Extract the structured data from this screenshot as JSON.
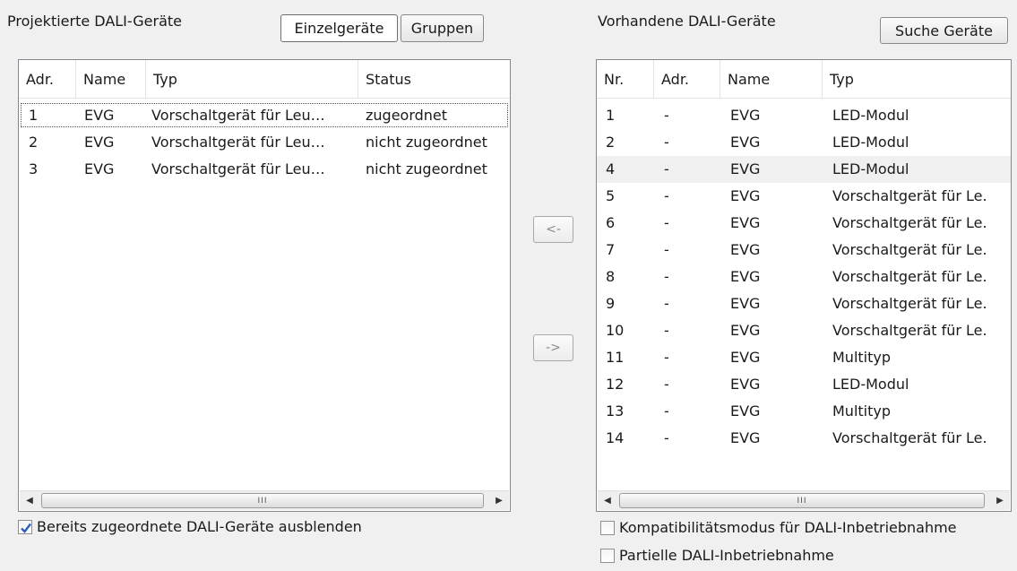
{
  "left": {
    "title": "Projektierte DALI-Geräte",
    "btn_single": "Einzelgeräte",
    "btn_groups": "Gruppen",
    "columns": [
      "Adr.",
      "Name",
      "Typ",
      "Status"
    ],
    "rows": [
      [
        "1",
        "EVG",
        "Vorschaltgerät für Leu…",
        "zugeordnet"
      ],
      [
        "2",
        "EVG",
        "Vorschaltgerät für Leu…",
        "nicht zugeordnet"
      ],
      [
        "3",
        "EVG",
        "Vorschaltgerät für Leu…",
        "nicht zugeordnet"
      ]
    ],
    "hide_checkbox": {
      "label": "Bereits zugeordnete DALI-Geräte ausblenden",
      "checked": true
    }
  },
  "arrows": {
    "left": "<-",
    "right": "->"
  },
  "right": {
    "title": "Vorhandene DALI-Geräte",
    "btn_search": "Suche Geräte",
    "columns": [
      "Nr.",
      "Adr.",
      "Name",
      "Typ"
    ],
    "rows": [
      [
        "1",
        "-",
        "EVG",
        "LED-Modul"
      ],
      [
        "2",
        "-",
        "EVG",
        "LED-Modul"
      ],
      [
        "4",
        "-",
        "EVG",
        "LED-Modul"
      ],
      [
        "5",
        "-",
        "EVG",
        "Vorschaltgerät für Le."
      ],
      [
        "6",
        "-",
        "EVG",
        "Vorschaltgerät für Le."
      ],
      [
        "7",
        "-",
        "EVG",
        "Vorschaltgerät für Le."
      ],
      [
        "8",
        "-",
        "EVG",
        "Vorschaltgerät für Le."
      ],
      [
        "9",
        "-",
        "EVG",
        "Vorschaltgerät für Le."
      ],
      [
        "10",
        "-",
        "EVG",
        "Vorschaltgerät für Le."
      ],
      [
        "11",
        "-",
        "EVG",
        "Multityp"
      ],
      [
        "12",
        "-",
        "EVG",
        "LED-Modul"
      ],
      [
        "13",
        "-",
        "EVG",
        "Multityp"
      ],
      [
        "14",
        "-",
        "EVG",
        "Vorschaltgerät für Le."
      ]
    ],
    "compat_checkbox": {
      "label": "Kompatibilitätsmodus für DALI-Inbetriebnahme",
      "checked": false
    },
    "partial_checkbox": {
      "label": "Partielle DALI-Inbetriebnahme",
      "checked": false
    }
  },
  "scroll_thumb": "III"
}
